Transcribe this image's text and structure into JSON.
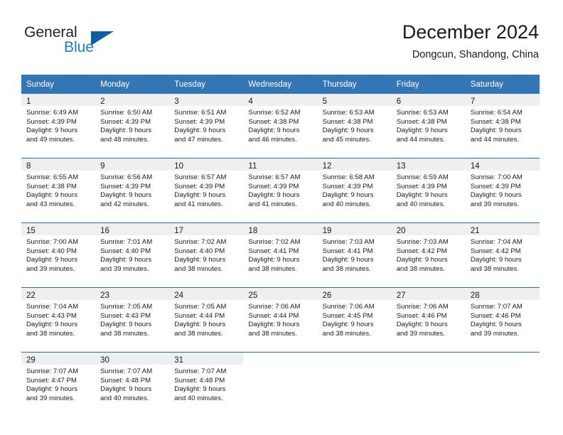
{
  "brand": {
    "word_one": "General",
    "word_two": "Blue",
    "flag_icon": "triangle-flag-icon"
  },
  "header": {
    "title": "December 2024",
    "subtitle": "Dongcun, Shandong, China"
  },
  "colors": {
    "header_blue": "#3476b5",
    "row_divider_blue": "#2e6da4",
    "daynum_band": "#efefef",
    "brand_blue": "#1a7fc1",
    "brand_flag": "#0e5ea5"
  },
  "calendar": {
    "weekdays": [
      "Sunday",
      "Monday",
      "Tuesday",
      "Wednesday",
      "Thursday",
      "Friday",
      "Saturday"
    ],
    "weeks": [
      [
        {
          "day": "1",
          "sunrise": "Sunrise: 6:49 AM",
          "sunset": "Sunset: 4:39 PM",
          "daylight_line1": "Daylight: 9 hours",
          "daylight_line2": "and 49 minutes."
        },
        {
          "day": "2",
          "sunrise": "Sunrise: 6:50 AM",
          "sunset": "Sunset: 4:39 PM",
          "daylight_line1": "Daylight: 9 hours",
          "daylight_line2": "and 48 minutes."
        },
        {
          "day": "3",
          "sunrise": "Sunrise: 6:51 AM",
          "sunset": "Sunset: 4:39 PM",
          "daylight_line1": "Daylight: 9 hours",
          "daylight_line2": "and 47 minutes."
        },
        {
          "day": "4",
          "sunrise": "Sunrise: 6:52 AM",
          "sunset": "Sunset: 4:38 PM",
          "daylight_line1": "Daylight: 9 hours",
          "daylight_line2": "and 46 minutes."
        },
        {
          "day": "5",
          "sunrise": "Sunrise: 6:53 AM",
          "sunset": "Sunset: 4:38 PM",
          "daylight_line1": "Daylight: 9 hours",
          "daylight_line2": "and 45 minutes."
        },
        {
          "day": "6",
          "sunrise": "Sunrise: 6:53 AM",
          "sunset": "Sunset: 4:38 PM",
          "daylight_line1": "Daylight: 9 hours",
          "daylight_line2": "and 44 minutes."
        },
        {
          "day": "7",
          "sunrise": "Sunrise: 6:54 AM",
          "sunset": "Sunset: 4:38 PM",
          "daylight_line1": "Daylight: 9 hours",
          "daylight_line2": "and 44 minutes."
        }
      ],
      [
        {
          "day": "8",
          "sunrise": "Sunrise: 6:55 AM",
          "sunset": "Sunset: 4:38 PM",
          "daylight_line1": "Daylight: 9 hours",
          "daylight_line2": "and 43 minutes."
        },
        {
          "day": "9",
          "sunrise": "Sunrise: 6:56 AM",
          "sunset": "Sunset: 4:39 PM",
          "daylight_line1": "Daylight: 9 hours",
          "daylight_line2": "and 42 minutes."
        },
        {
          "day": "10",
          "sunrise": "Sunrise: 6:57 AM",
          "sunset": "Sunset: 4:39 PM",
          "daylight_line1": "Daylight: 9 hours",
          "daylight_line2": "and 41 minutes."
        },
        {
          "day": "11",
          "sunrise": "Sunrise: 6:57 AM",
          "sunset": "Sunset: 4:39 PM",
          "daylight_line1": "Daylight: 9 hours",
          "daylight_line2": "and 41 minutes."
        },
        {
          "day": "12",
          "sunrise": "Sunrise: 6:58 AM",
          "sunset": "Sunset: 4:39 PM",
          "daylight_line1": "Daylight: 9 hours",
          "daylight_line2": "and 40 minutes."
        },
        {
          "day": "13",
          "sunrise": "Sunrise: 6:59 AM",
          "sunset": "Sunset: 4:39 PM",
          "daylight_line1": "Daylight: 9 hours",
          "daylight_line2": "and 40 minutes."
        },
        {
          "day": "14",
          "sunrise": "Sunrise: 7:00 AM",
          "sunset": "Sunset: 4:39 PM",
          "daylight_line1": "Daylight: 9 hours",
          "daylight_line2": "and 39 minutes."
        }
      ],
      [
        {
          "day": "15",
          "sunrise": "Sunrise: 7:00 AM",
          "sunset": "Sunset: 4:40 PM",
          "daylight_line1": "Daylight: 9 hours",
          "daylight_line2": "and 39 minutes."
        },
        {
          "day": "16",
          "sunrise": "Sunrise: 7:01 AM",
          "sunset": "Sunset: 4:40 PM",
          "daylight_line1": "Daylight: 9 hours",
          "daylight_line2": "and 39 minutes."
        },
        {
          "day": "17",
          "sunrise": "Sunrise: 7:02 AM",
          "sunset": "Sunset: 4:40 PM",
          "daylight_line1": "Daylight: 9 hours",
          "daylight_line2": "and 38 minutes."
        },
        {
          "day": "18",
          "sunrise": "Sunrise: 7:02 AM",
          "sunset": "Sunset: 4:41 PM",
          "daylight_line1": "Daylight: 9 hours",
          "daylight_line2": "and 38 minutes."
        },
        {
          "day": "19",
          "sunrise": "Sunrise: 7:03 AM",
          "sunset": "Sunset: 4:41 PM",
          "daylight_line1": "Daylight: 9 hours",
          "daylight_line2": "and 38 minutes."
        },
        {
          "day": "20",
          "sunrise": "Sunrise: 7:03 AM",
          "sunset": "Sunset: 4:42 PM",
          "daylight_line1": "Daylight: 9 hours",
          "daylight_line2": "and 38 minutes."
        },
        {
          "day": "21",
          "sunrise": "Sunrise: 7:04 AM",
          "sunset": "Sunset: 4:42 PM",
          "daylight_line1": "Daylight: 9 hours",
          "daylight_line2": "and 38 minutes."
        }
      ],
      [
        {
          "day": "22",
          "sunrise": "Sunrise: 7:04 AM",
          "sunset": "Sunset: 4:43 PM",
          "daylight_line1": "Daylight: 9 hours",
          "daylight_line2": "and 38 minutes."
        },
        {
          "day": "23",
          "sunrise": "Sunrise: 7:05 AM",
          "sunset": "Sunset: 4:43 PM",
          "daylight_line1": "Daylight: 9 hours",
          "daylight_line2": "and 38 minutes."
        },
        {
          "day": "24",
          "sunrise": "Sunrise: 7:05 AM",
          "sunset": "Sunset: 4:44 PM",
          "daylight_line1": "Daylight: 9 hours",
          "daylight_line2": "and 38 minutes."
        },
        {
          "day": "25",
          "sunrise": "Sunrise: 7:06 AM",
          "sunset": "Sunset: 4:44 PM",
          "daylight_line1": "Daylight: 9 hours",
          "daylight_line2": "and 38 minutes."
        },
        {
          "day": "26",
          "sunrise": "Sunrise: 7:06 AM",
          "sunset": "Sunset: 4:45 PM",
          "daylight_line1": "Daylight: 9 hours",
          "daylight_line2": "and 38 minutes."
        },
        {
          "day": "27",
          "sunrise": "Sunrise: 7:06 AM",
          "sunset": "Sunset: 4:46 PM",
          "daylight_line1": "Daylight: 9 hours",
          "daylight_line2": "and 39 minutes."
        },
        {
          "day": "28",
          "sunrise": "Sunrise: 7:07 AM",
          "sunset": "Sunset: 4:46 PM",
          "daylight_line1": "Daylight: 9 hours",
          "daylight_line2": "and 39 minutes."
        }
      ],
      [
        {
          "day": "29",
          "sunrise": "Sunrise: 7:07 AM",
          "sunset": "Sunset: 4:47 PM",
          "daylight_line1": "Daylight: 9 hours",
          "daylight_line2": "and 39 minutes."
        },
        {
          "day": "30",
          "sunrise": "Sunrise: 7:07 AM",
          "sunset": "Sunset: 4:48 PM",
          "daylight_line1": "Daylight: 9 hours",
          "daylight_line2": "and 40 minutes."
        },
        {
          "day": "31",
          "sunrise": "Sunrise: 7:07 AM",
          "sunset": "Sunset: 4:48 PM",
          "daylight_line1": "Daylight: 9 hours",
          "daylight_line2": "and 40 minutes."
        },
        {
          "day": "",
          "sunrise": "",
          "sunset": "",
          "daylight_line1": "",
          "daylight_line2": ""
        },
        {
          "day": "",
          "sunrise": "",
          "sunset": "",
          "daylight_line1": "",
          "daylight_line2": ""
        },
        {
          "day": "",
          "sunrise": "",
          "sunset": "",
          "daylight_line1": "",
          "daylight_line2": ""
        },
        {
          "day": "",
          "sunrise": "",
          "sunset": "",
          "daylight_line1": "",
          "daylight_line2": ""
        }
      ]
    ]
  }
}
